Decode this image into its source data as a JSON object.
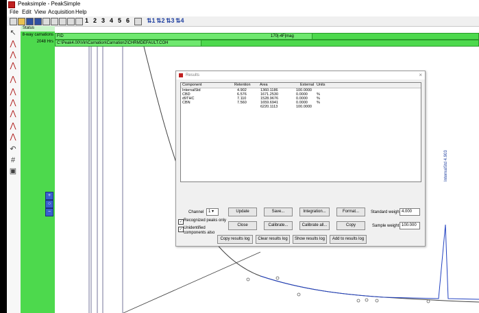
{
  "window": {
    "title": "Peaksimple - PeakSimple"
  },
  "menu": [
    "File",
    "Edit",
    "View",
    "Acquisition",
    "Help"
  ],
  "toolbar": {
    "channels": [
      "1",
      "2",
      "3",
      "4",
      "5",
      "6"
    ],
    "ranges": [
      "1",
      "2",
      "3",
      "4"
    ]
  },
  "channel_panel": {
    "header": "Status",
    "name_label": "8-way carnations",
    "count_label": "2048 Hrs"
  },
  "strips": {
    "detector": "FID",
    "range": "170|-4F|mag",
    "path": "C:\\Peak4.00\\Vin\\Carnation\\Carnation2\\CHRMDEFAULT.COH"
  },
  "results": {
    "title": "Results",
    "columns": [
      "Component",
      "Retention",
      "Area",
      "External",
      "Units"
    ],
    "rows": [
      {
        "component": "InternalStd",
        "retention": "4.902",
        "area": "1360.1186",
        "external": "100.0000",
        "units": ""
      },
      {
        "component": "CBD",
        "retention": "6.576",
        "area": "1671.2530",
        "external": "0.0000",
        "units": "%"
      },
      {
        "component": "d9THC",
        "retention": "7.110",
        "area": "1528.9676",
        "external": "0.0000",
        "units": "%"
      },
      {
        "component": "CBN",
        "retention": "7.560",
        "area": "1659.6941",
        "external": "0.0000",
        "units": "%"
      },
      {
        "component": "",
        "retention": "",
        "area": "6220.1113",
        "external": "100.0000",
        "units": ""
      }
    ],
    "channel_label": "Channel",
    "channel_value": "1",
    "buttons": {
      "update": "Update",
      "save": "Save...",
      "integration": "Integration...",
      "format": "Format...",
      "close": "Close",
      "calibrate": "Calibrate...",
      "calibrate_all": "Calibrate all...",
      "copy": "Copy",
      "copy_log": "Copy results log",
      "clear_log": "Clear results log",
      "show_log": "Show results log",
      "add_log": "Add to results log"
    },
    "check_recognized": "Recognized peaks only",
    "check_unidentified": "Unidentified components also",
    "standard_weight_label": "Standard weight",
    "standard_weight_value": "4.000",
    "sample_weight_label": "Sample weight",
    "sample_weight_value": "100.000"
  },
  "peak_annotation": "InternalStd 4.903",
  "colors": {
    "accent_green": "#4dd94d",
    "trace_blue": "#2040c0"
  }
}
